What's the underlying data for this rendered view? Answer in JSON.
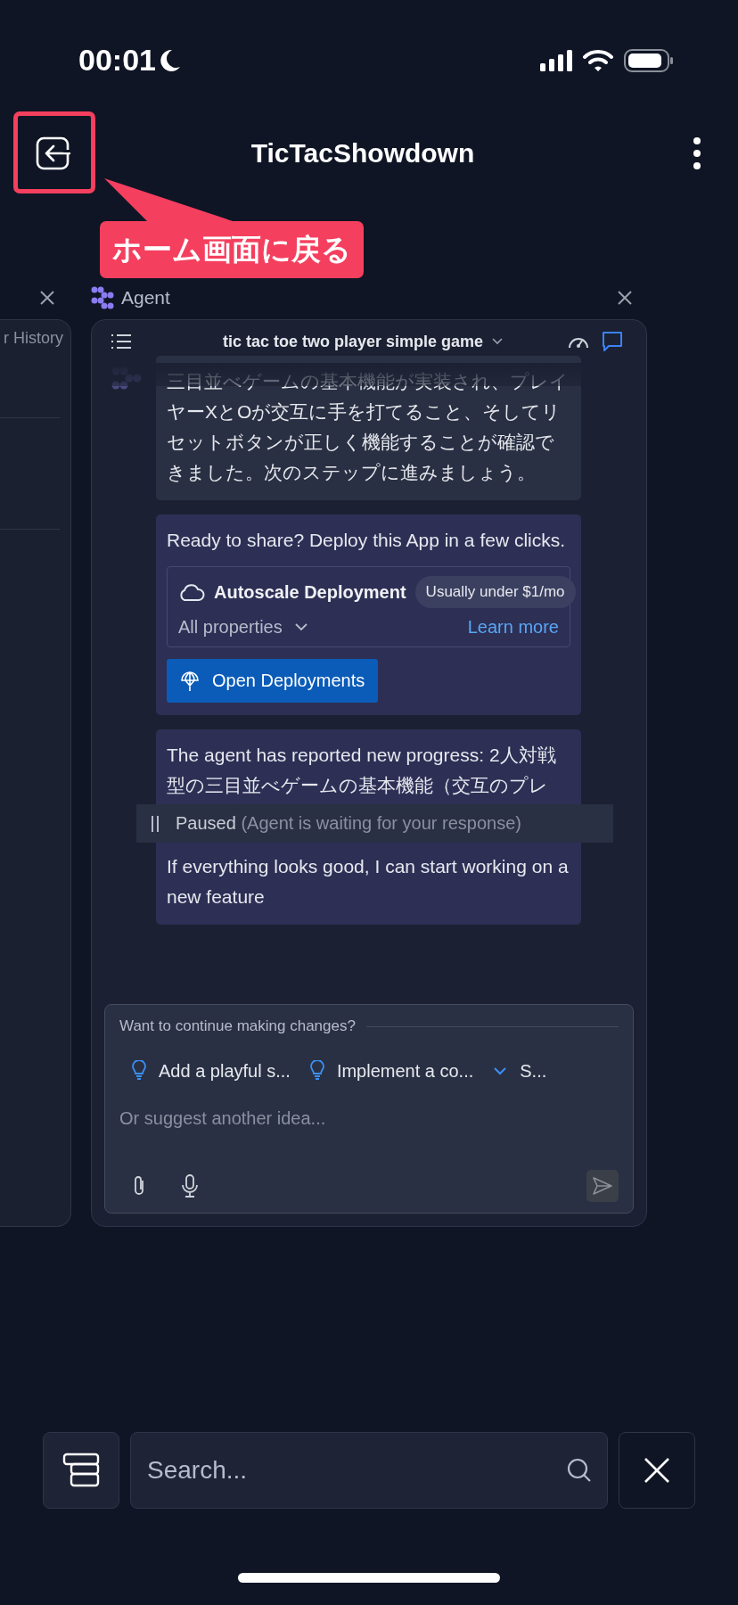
{
  "status_bar": {
    "time": "00:01"
  },
  "header": {
    "title": "TicTacShowdown"
  },
  "callout": {
    "text": "ホーム画面に戻る"
  },
  "left_panel": {
    "title": "r History"
  },
  "agent_panel": {
    "label": "Agent",
    "chat_title": "tic tac toe two player simple game",
    "messages": [
      {
        "kind": "text",
        "text": "三目並べゲームの基本機能が実装され、プレイヤーXとOが交互に手を打てること、そしてリセットボタンが正しく機能することが確認できました。次のステップに進みましょう。"
      },
      {
        "kind": "deploy",
        "text": "Ready to share? Deploy this App in a few clicks.",
        "title": "Autoscale Deployment",
        "badge": "Usually under $1/mo",
        "properties": "All properties",
        "link": "Learn more",
        "button": "Open Deployments"
      },
      {
        "kind": "progress",
        "text": "The agent has reported new progress: 2人対戦型の三目並べゲームの基本機能（交互のプレ",
        "status": "Paused",
        "note": "(Agent is waiting for your response)",
        "text_after": "If everything looks good, I can start working on a new feature"
      }
    ],
    "composer": {
      "prompt": "Want to continue making changes?",
      "suggestions": [
        {
          "kind": "idea",
          "label": "Add a playful s..."
        },
        {
          "kind": "idea",
          "label": "Implement a co..."
        },
        {
          "kind": "more",
          "label": "S..."
        }
      ],
      "placeholder": "Or suggest another idea..."
    }
  },
  "bottom_bar": {
    "search": {
      "placeholder": "Search..."
    }
  }
}
